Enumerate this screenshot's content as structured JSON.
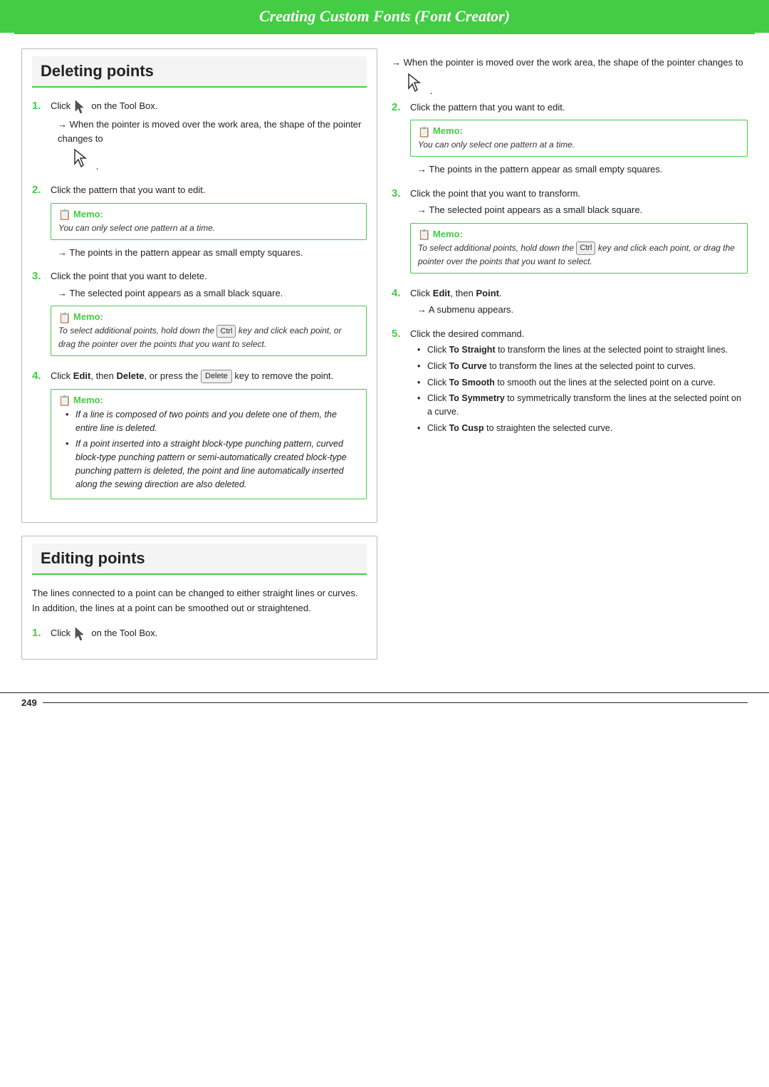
{
  "header": {
    "title": "Creating Custom Fonts (Font Creator)"
  },
  "left_section": {
    "title": "Deleting points",
    "steps": [
      {
        "num": "1.",
        "text": "Click",
        "after_icon": true,
        "after_text": "on the Tool Box.",
        "arrow": "When the pointer is moved over the work area, the shape of the pointer changes to",
        "show_cursor": true
      },
      {
        "num": "2.",
        "text": "Click the pattern that you want to edit.",
        "memo": {
          "title": "Memo:",
          "body": "You can only select one pattern at a time."
        },
        "arrow": "The points in the pattern appear as small empty squares."
      },
      {
        "num": "3.",
        "text": "Click the point that you want to delete.",
        "arrow": "The selected point appears as a small black square."
      },
      {
        "num": "4.",
        "text_parts": [
          "Click ",
          "Edit",
          ", then ",
          "Delete",
          ", or press the ",
          "Delete_badge",
          " key to remove the point."
        ]
      }
    ],
    "step3_memo": {
      "title": "Memo:",
      "body_parts": [
        "To select additional points, hold down the ",
        "Ctrl",
        " key and click each point, or drag the pointer over the points that you want to select."
      ]
    },
    "step4_memo": {
      "title": "Memo:",
      "bullets": [
        "If a line is composed of two points and you delete one of them, the entire line is deleted.",
        "If a point inserted into a straight block-type punching pattern, curved block-type punching pattern or semi-automatically created block-type punching pattern is deleted, the point and line automatically inserted along the sewing direction are also deleted."
      ]
    }
  },
  "editing_section": {
    "title": "Editing points",
    "intro": "The lines connected to a point can be changed to either straight lines or curves. In addition, the lines at a point can be smoothed out or straightened.",
    "step1": {
      "num": "1.",
      "text": "Click",
      "after_text": "on the Tool Box."
    }
  },
  "right_section": {
    "arrow1": "When the pointer is moved over the work area, the shape of the pointer changes to",
    "show_cursor": true,
    "step2": {
      "num": "2.",
      "text": "Click the pattern that you want to edit.",
      "memo": {
        "title": "Memo:",
        "body": "You can only select one pattern at a time."
      },
      "arrow": "The points in the pattern appear as small empty squares."
    },
    "step3": {
      "num": "3.",
      "text": "Click the point that you want to transform.",
      "arrow": "The selected point appears as a small black square.",
      "memo": {
        "title": "Memo:",
        "body_parts": [
          "To select additional points, hold down the ",
          "Ctrl",
          " key and click each point, or drag the pointer over the points that you want to select."
        ]
      }
    },
    "step4": {
      "num": "4.",
      "text_parts": [
        "Click ",
        "Edit",
        ", then ",
        "Point",
        "."
      ],
      "arrow": "A submenu appears."
    },
    "step5": {
      "num": "5.",
      "text": "Click the desired command.",
      "bullets": [
        {
          "pre": "Click ",
          "bold": "To Straight",
          "post": " to transform the lines at the selected point to straight lines."
        },
        {
          "pre": "Click ",
          "bold": "To Curve",
          "post": " to transform the lines at the selected point to curves."
        },
        {
          "pre": "Click ",
          "bold": "To Smooth",
          "post": " to smooth out the lines at the selected point on a curve."
        },
        {
          "pre": "Click ",
          "bold": "To Symmetry",
          "post": " to symmetrically transform the lines at the selected point on a curve."
        },
        {
          "pre": "Click ",
          "bold": "To Cusp",
          "post": " to straighten the selected curve."
        }
      ]
    }
  },
  "footer": {
    "page_number": "249"
  }
}
